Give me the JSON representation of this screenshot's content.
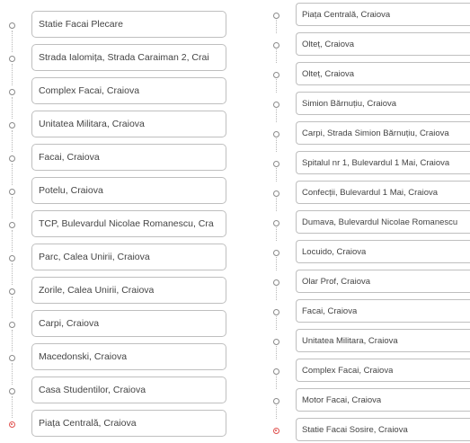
{
  "left_route": {
    "stops": [
      {
        "name": "Statie Facai Plecare",
        "final": false
      },
      {
        "name": "Strada Ialomița, Strada Caraiman 2, Crai",
        "final": false
      },
      {
        "name": "Complex Facai, Craiova",
        "final": false
      },
      {
        "name": "Unitatea Militara, Craiova",
        "final": false
      },
      {
        "name": "Facai, Craiova",
        "final": false
      },
      {
        "name": "Potelu, Craiova",
        "final": false
      },
      {
        "name": "TCP, Bulevardul Nicolae Romanescu, Cra",
        "final": false
      },
      {
        "name": "Parc, Calea Unirii, Craiova",
        "final": false
      },
      {
        "name": "Zorile, Calea Unirii, Craiova",
        "final": false
      },
      {
        "name": "Carpi, Craiova",
        "final": false
      },
      {
        "name": "Macedonski, Craiova",
        "final": false
      },
      {
        "name": "Casa Studentilor, Craiova",
        "final": false
      },
      {
        "name": "Piața Centrală, Craiova",
        "final": true
      }
    ]
  },
  "right_route": {
    "stops": [
      {
        "name": "Piața Centrală, Craiova",
        "final": false
      },
      {
        "name": "Olteț, Craiova",
        "final": false
      },
      {
        "name": "Olteț, Craiova",
        "final": false
      },
      {
        "name": "Simion Bărnuțiu, Craiova",
        "final": false
      },
      {
        "name": "Carpi, Strada Simion Bărnuțiu, Craiova",
        "final": false
      },
      {
        "name": "Spitalul nr 1, Bulevardul 1 Mai, Craiova",
        "final": false
      },
      {
        "name": "Confecții, Bulevardul 1 Mai, Craiova",
        "final": false
      },
      {
        "name": "Dumava, Bulevardul Nicolae Romanescu",
        "final": false
      },
      {
        "name": "Locuido, Craiova",
        "final": false
      },
      {
        "name": "Olar Prof, Craiova",
        "final": false
      },
      {
        "name": "Facai, Craiova",
        "final": false
      },
      {
        "name": "Unitatea Militara, Craiova",
        "final": false
      },
      {
        "name": "Complex Facai, Craiova",
        "final": false
      },
      {
        "name": "Motor Facai, Craiova",
        "final": false
      },
      {
        "name": "Statie Facai Sosire, Craiova",
        "final": true
      }
    ]
  }
}
